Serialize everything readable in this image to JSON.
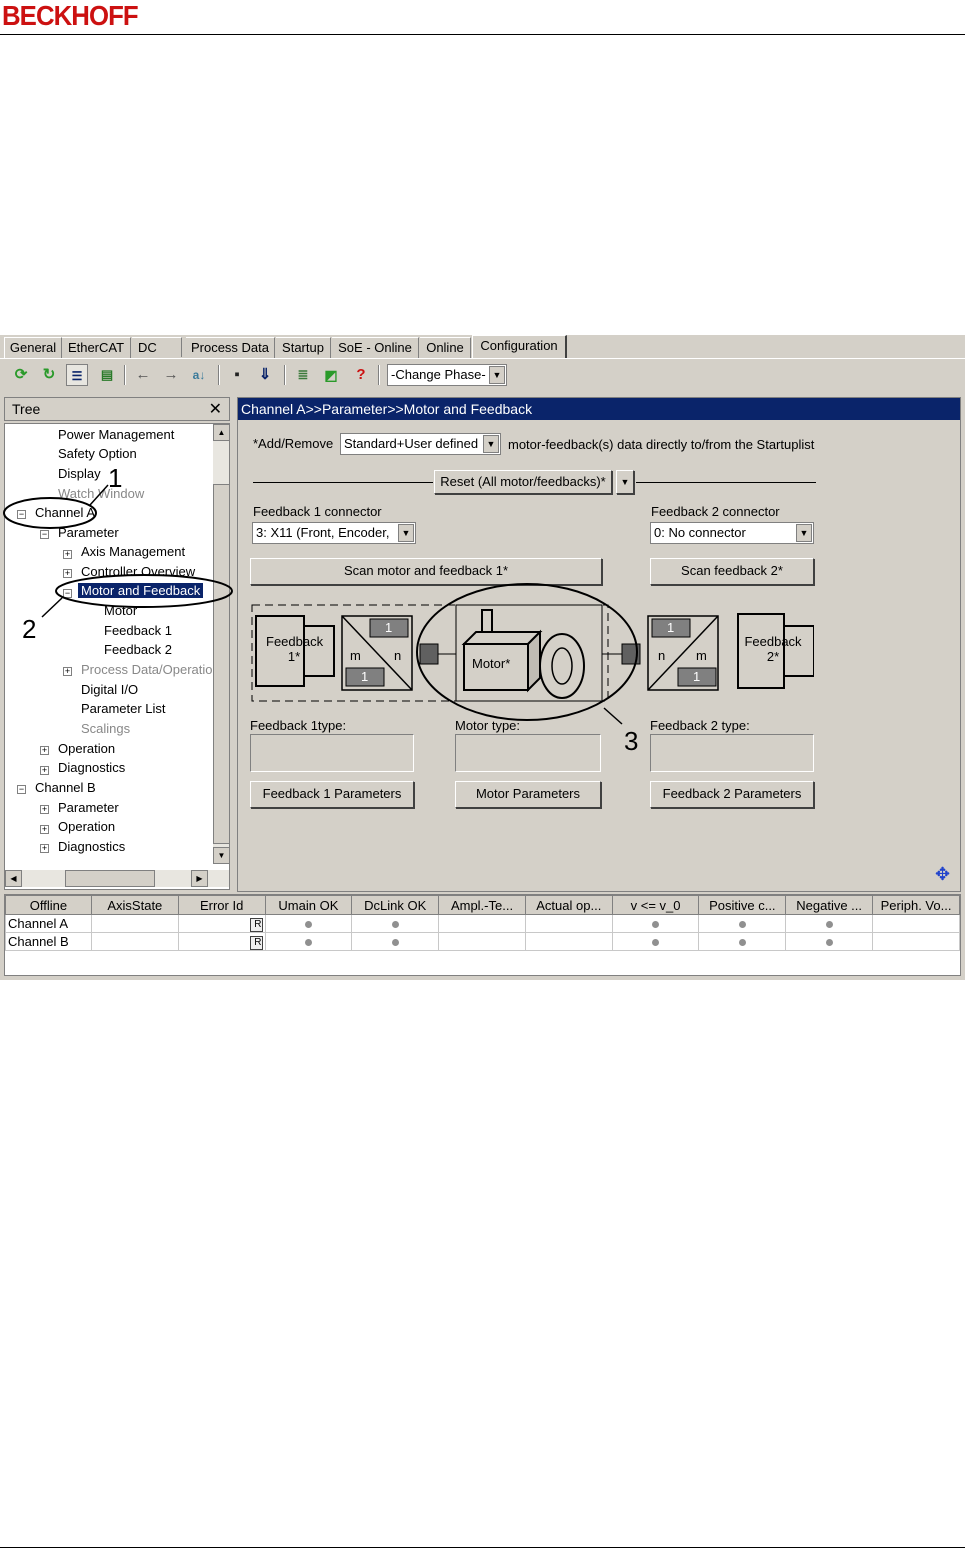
{
  "header": {
    "logo": "BECKHOFF"
  },
  "tabs": [
    "General",
    "EtherCAT",
    "DC",
    "Process Data",
    "Startup",
    "SoE - Online",
    "Online",
    "Configuration"
  ],
  "toolbar": {
    "phase_combo": "-Change Phase-"
  },
  "tree": {
    "title": "Tree",
    "close": "✕",
    "nodes": {
      "power_management": "Power Management",
      "safety_option": "Safety Option",
      "display": "Display",
      "watch_window": "Watch Window",
      "channel_a": "Channel A",
      "parameter": "Parameter",
      "axis_management": "Axis Management",
      "controller_overview": "Controller Overview",
      "motor_and_feedback": "Motor and Feedback",
      "motor": "Motor",
      "feedback1": "Feedback 1",
      "feedback2": "Feedback 2",
      "process_data": "Process Data/Operation",
      "digital_io": "Digital I/O",
      "parameter_list": "Parameter List",
      "scalings": "Scalings",
      "operation": "Operation",
      "diagnostics": "Diagnostics",
      "channel_b": "Channel B",
      "b_parameter": "Parameter",
      "b_operation": "Operation",
      "b_diagnostics": "Diagnostics"
    }
  },
  "panel": {
    "breadcrumb": "Channel A>>Parameter>>Motor and Feedback",
    "add_remove_label": "*Add/Remove",
    "add_remove_value": "Standard+User defined",
    "add_remove_suffix": "motor-feedback(s) data directly to/from the Startuplist",
    "reset_button": "Reset (All motor/feedbacks)*",
    "fb1_connector_label": "Feedback 1 connector",
    "fb1_connector_value": "3: X11 (Front, Encoder,",
    "fb2_connector_label": "Feedback 2 connector",
    "fb2_connector_value": "0: No connector",
    "scan_motor_fb1": "Scan motor and feedback 1*",
    "scan_fb2": "Scan feedback 2*",
    "diagram": {
      "feedback1": "Feedback 1*",
      "motor": "Motor*",
      "feedback2": "Feedback 2*",
      "m": "m",
      "n": "n",
      "one": "1"
    },
    "fb1_type_label": "Feedback 1type:",
    "motor_type_label": "Motor type:",
    "fb2_type_label": "Feedback 2 type:",
    "fb1_params_button": "Feedback 1 Parameters",
    "motor_params_button": "Motor Parameters",
    "fb2_params_button": "Feedback 2 Parameters"
  },
  "status_table": {
    "columns": [
      "Offline",
      "AxisState",
      "Error Id",
      "Umain OK",
      "DcLink OK",
      "Ampl.-Te...",
      "Actual op...",
      "v <= v_0",
      "Positive c...",
      "Negative ...",
      "Periph. Vo..."
    ],
    "rows": [
      {
        "name": "Channel A",
        "reset": "R"
      },
      {
        "name": "Channel B",
        "reset": "R"
      }
    ]
  },
  "annotations": [
    "1",
    "2",
    "3"
  ]
}
